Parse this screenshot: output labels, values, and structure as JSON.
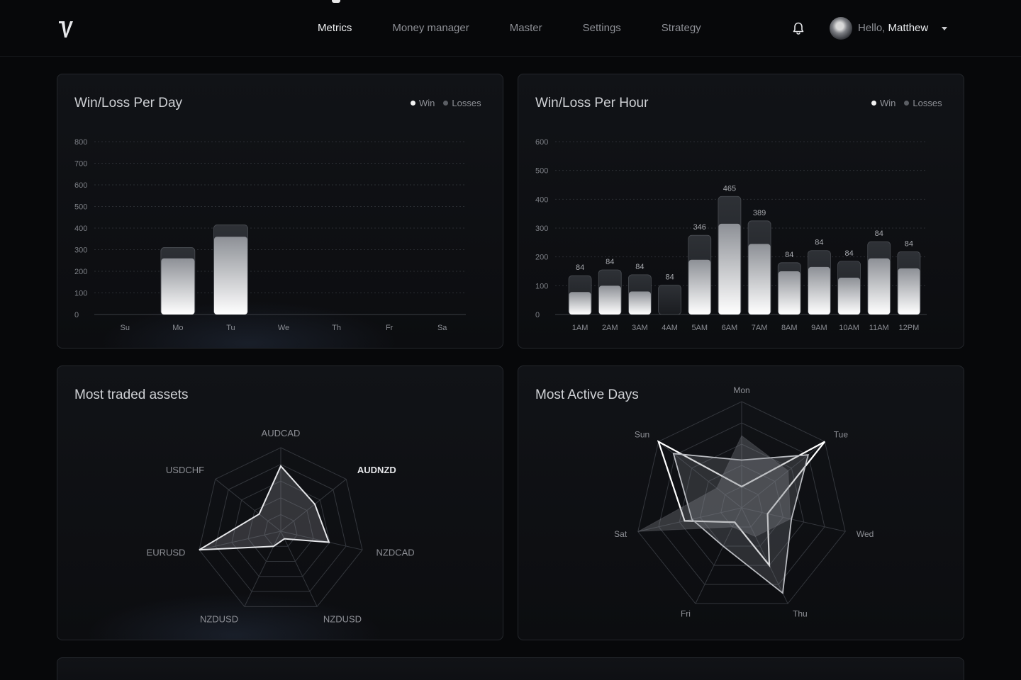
{
  "nav": {
    "items": [
      "Metrics",
      "Money manager",
      "Master",
      "Settings",
      "Strategy"
    ],
    "active": "Metrics"
  },
  "user": {
    "greeting": "Hello,",
    "name": "Matthew"
  },
  "legend": {
    "win": "Win",
    "losses": "Losses"
  },
  "colors": {
    "background": "#07080a",
    "card": "#111317",
    "accent": "#f2f2f2",
    "muted": "#8e9096"
  },
  "chart_data": [
    {
      "type": "bar",
      "title": "Win/Loss Per Day",
      "categories": [
        "Su",
        "Mo",
        "Tu",
        "We",
        "Th",
        "Fr",
        "Sa"
      ],
      "series": [
        {
          "name": "Win",
          "values": [
            0,
            260,
            360,
            0,
            0,
            0,
            0
          ]
        },
        {
          "name": "Losses",
          "values": [
            0,
            310,
            415,
            0,
            0,
            0,
            0
          ]
        }
      ],
      "ylim": [
        0,
        800
      ],
      "yticks": [
        0,
        100,
        200,
        300,
        400,
        500,
        600,
        700,
        800
      ],
      "grid": true,
      "legend": "top-right"
    },
    {
      "type": "bar",
      "title": "Win/Loss Per Hour",
      "categories": [
        "1AM",
        "2AM",
        "3AM",
        "4AM",
        "5AM",
        "6AM",
        "7AM",
        "8AM",
        "9AM",
        "10AM",
        "11AM",
        "12PM"
      ],
      "labels": [
        "84",
        "84",
        "84",
        "84",
        "346",
        "465",
        "389",
        "84",
        "84",
        "84",
        "84",
        "84"
      ],
      "series": [
        {
          "name": "Win",
          "values": [
            78,
            100,
            80,
            0,
            190,
            315,
            245,
            150,
            165,
            128,
            195,
            160
          ]
        },
        {
          "name": "Losses",
          "values": [
            135,
            155,
            138,
            102,
            275,
            410,
            325,
            180,
            222,
            185,
            253,
            218
          ]
        }
      ],
      "ylim": [
        0,
        600
      ],
      "yticks": [
        0,
        100,
        200,
        300,
        400,
        500,
        600
      ],
      "grid": true,
      "legend": "top-right"
    },
    {
      "type": "radar",
      "title": "Most traded assets",
      "axes": [
        "AUDCAD",
        "AUDNZD",
        "NZDCAD",
        "NZDUSD",
        "NZDUSD",
        "EURUSD",
        "USDCHF"
      ],
      "highlight_axis": "AUDNZD",
      "series": [
        {
          "values": [
            0.78,
            0.52,
            0.59,
            0.1,
            0.2,
            1.0,
            0.33
          ]
        }
      ],
      "rlim": [
        0,
        1
      ]
    },
    {
      "type": "radar",
      "title": "Most Active Days",
      "axes": [
        "Mon",
        "Tue",
        "Wed",
        "Thu",
        "Fri",
        "Sat",
        "Sun"
      ],
      "series": [
        {
          "values": [
            0.2,
            1.0,
            0.25,
            0.6,
            0.15,
            0.55,
            1.0
          ]
        },
        {
          "values": [
            0.45,
            0.8,
            0.48,
            0.89,
            0.4,
            0.48,
            0.82
          ]
        },
        {
          "values": [
            0.68,
            0.56,
            0.47,
            0.3,
            0.2,
            1.0,
            0.3
          ]
        }
      ],
      "rlim": [
        0,
        1
      ]
    }
  ]
}
